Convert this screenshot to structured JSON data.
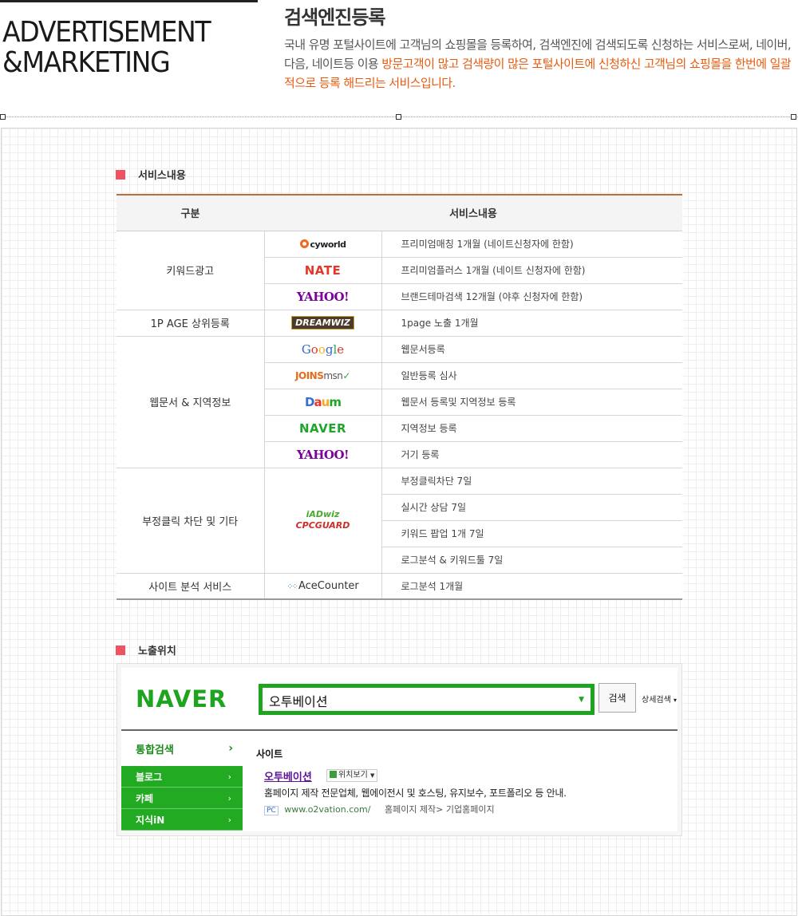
{
  "header": {
    "brand_line1": "ADVERTISEMENT",
    "brand_line2": "&MARKETING",
    "title": "검색엔진등록",
    "intro_plain1": "국내 유명 포털사이트에 고객님의 쇼핑몰을 등록하여, 검색엔진에 검색되도록 신청하는 서비스로써, 네이버, 다음, 네이트등 이용 ",
    "intro_highlight": "방문고객이 많고 검색량이 많은 포털사이트에 신청하신 고객님의 쇼핑몰을 한번에 일괄적으로 등록 해드리는 서비스입니다."
  },
  "service_section": {
    "heading": "서비스내용",
    "col_category": "구분",
    "col_content": "서비스내용",
    "groups": [
      {
        "category": "키워드광고",
        "rows": [
          {
            "logo": "cyworld",
            "logo_text": "cyworld",
            "desc": "프리미엄매칭 1개월 (네이트신청자에 한함)"
          },
          {
            "logo": "nate",
            "logo_text": "NATE",
            "desc": "프리미엄플러스 1개월 (네이트 신청자에 한함)"
          },
          {
            "logo": "yahoo",
            "logo_text": "YAHOO!",
            "desc": "브랜드테마검색 12개월 (야후 신청자에 한함)"
          }
        ]
      },
      {
        "category": "1P AGE 상위등록",
        "rows": [
          {
            "logo": "dreamwiz",
            "logo_text": "DREAMWIZ",
            "desc": "1page 노출 1개월"
          }
        ]
      },
      {
        "category": "웹문서 & 지역정보",
        "rows": [
          {
            "logo": "google",
            "logo_text": "Google",
            "desc": "웹문서등록"
          },
          {
            "logo": "joinsmsn",
            "logo_text": "JOINSmsn",
            "desc": "일반등록 심사"
          },
          {
            "logo": "daum",
            "logo_text": "Daum",
            "desc": "웹문서 등록및 지역정보 등록"
          },
          {
            "logo": "naver",
            "logo_text": "NAVER",
            "desc": "지역정보 등록"
          },
          {
            "logo": "yahoo",
            "logo_text": "YAHOO!",
            "desc": "거기 등록"
          }
        ]
      },
      {
        "category": "부정클릭 차단 및 기타",
        "logo": "iadwiz-cpcguard",
        "logo_text_1": "iADwiz",
        "logo_text_2": "CPCGUARD",
        "rows": [
          {
            "desc": "부정클릭차단 7일"
          },
          {
            "desc": "실시간 상담 7일"
          },
          {
            "desc": "키워드 팝업 1개 7일"
          },
          {
            "desc": "로그분석 & 키워드툴 7일"
          }
        ]
      },
      {
        "category": "사이트 분석 서비스",
        "rows": [
          {
            "logo": "acecounter",
            "logo_text": "AceCounter",
            "desc": "로그분석 1개월"
          }
        ]
      }
    ]
  },
  "exposure_section": {
    "heading": "노출위치",
    "naver_logo": "NAVER",
    "search_query": "오투베이션",
    "search_button": "검색",
    "detail_search": "상세검색",
    "side_active": "통합검색",
    "side_items": [
      "블로그",
      "카페",
      "지식iN"
    ],
    "result_section": "사이트",
    "result_title": "오투베이션",
    "map_button": "위치보기",
    "result_desc": "홈페이지 제작 전문업체, 웹에이전시 및 호스팅, 유지보수, 포트폴리오 등 안내.",
    "pc_badge": "PC",
    "result_url": "www.o2vation.com/",
    "result_path": "홈페이지 제작> 기업홈페이지"
  },
  "colors": {
    "accent_orange": "#ea5a0d",
    "section_marker": "#f05262",
    "naver_green": "#1ea41e",
    "table_top_border": "#b86f3e"
  }
}
